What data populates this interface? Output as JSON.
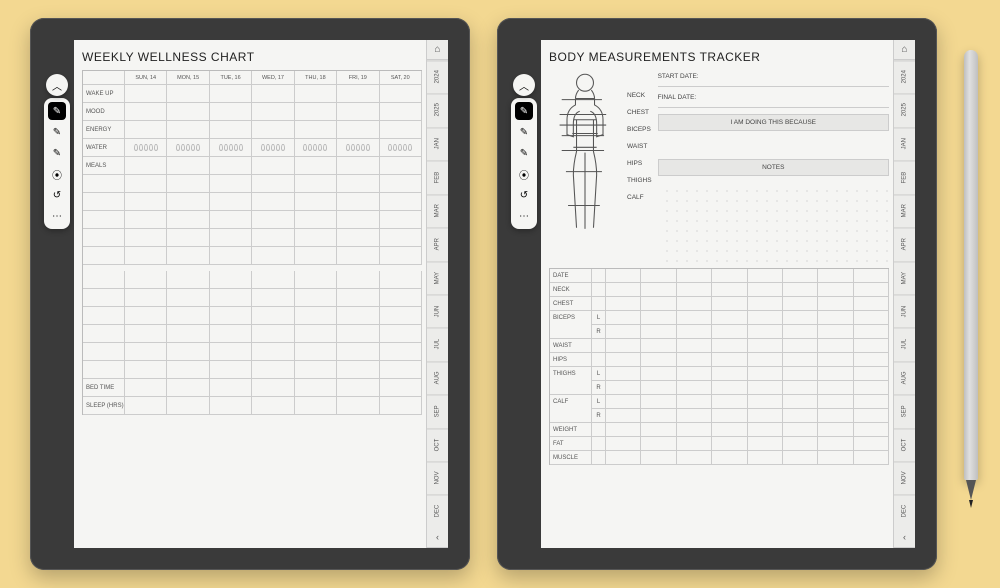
{
  "tabs": {
    "home_icon": "⌂",
    "years": [
      "2024",
      "2025"
    ],
    "months": [
      "JAN",
      "FEB",
      "MAR",
      "APR",
      "MAY",
      "JUN",
      "JUL",
      "AUG",
      "SEP",
      "OCT",
      "NOV",
      "DEC"
    ],
    "chev": "‹"
  },
  "toolbox": {
    "up": "︿",
    "tools": [
      "✎",
      "✎",
      "✎",
      "⦿",
      "↺",
      "⋯"
    ]
  },
  "wellness": {
    "title": "WEEKLY WELLNESS CHART",
    "days": [
      "SUN, 14",
      "MON, 15",
      "TUE, 16",
      "WED, 17",
      "THU, 18",
      "FRI, 19",
      "SAT, 20"
    ],
    "rows_top": [
      "WAKE UP",
      "MOOD",
      "ENERGY",
      "WATER"
    ],
    "meals_label": "MEALS",
    "meals_rows": 6,
    "blank_rows": 6,
    "rows_bottom": [
      "BED TIME",
      "SLEEP (HRS)"
    ]
  },
  "body": {
    "title": "BODY MEASUREMENTS TRACKER",
    "parts": [
      "NECK",
      "CHEST",
      "BICEPS",
      "WAIST",
      "HIPS",
      "THIGHS",
      "CALF"
    ],
    "start": "START DATE:",
    "final": "FINAL DATE:",
    "because": "I AM DOING THIS BECAUSE",
    "notes": "NOTES",
    "grid_cols": 8,
    "grid_rows": [
      {
        "label": "DATE"
      },
      {
        "label": "NECK"
      },
      {
        "label": "CHEST"
      },
      {
        "label": "BICEPS",
        "sub": [
          "L",
          "R"
        ]
      },
      {
        "label": "WAIST"
      },
      {
        "label": "HIPS"
      },
      {
        "label": "THIGHS",
        "sub": [
          "L",
          "R"
        ]
      },
      {
        "label": "CALF",
        "sub": [
          "L",
          "R"
        ]
      },
      {
        "label": "WEIGHT"
      },
      {
        "label": "FAT"
      },
      {
        "label": "MUSCLE"
      }
    ]
  }
}
